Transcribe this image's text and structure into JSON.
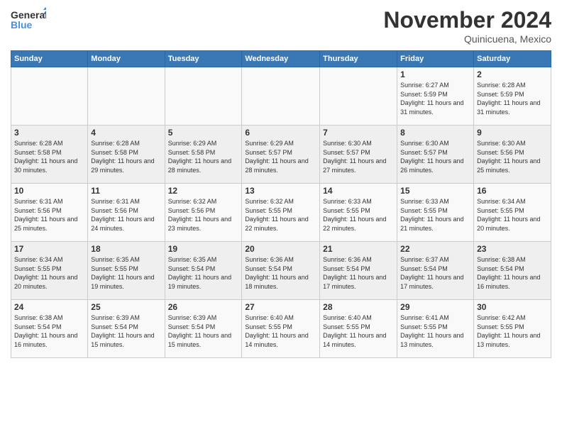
{
  "logo": {
    "line1": "General",
    "line2": "Blue"
  },
  "title": "November 2024",
  "subtitle": "Quinicuena, Mexico",
  "days_of_week": [
    "Sunday",
    "Monday",
    "Tuesday",
    "Wednesday",
    "Thursday",
    "Friday",
    "Saturday"
  ],
  "weeks": [
    [
      {
        "day": "",
        "info": ""
      },
      {
        "day": "",
        "info": ""
      },
      {
        "day": "",
        "info": ""
      },
      {
        "day": "",
        "info": ""
      },
      {
        "day": "",
        "info": ""
      },
      {
        "day": "1",
        "info": "Sunrise: 6:27 AM\nSunset: 5:59 PM\nDaylight: 11 hours and 31 minutes."
      },
      {
        "day": "2",
        "info": "Sunrise: 6:28 AM\nSunset: 5:59 PM\nDaylight: 11 hours and 31 minutes."
      }
    ],
    [
      {
        "day": "3",
        "info": "Sunrise: 6:28 AM\nSunset: 5:58 PM\nDaylight: 11 hours and 30 minutes."
      },
      {
        "day": "4",
        "info": "Sunrise: 6:28 AM\nSunset: 5:58 PM\nDaylight: 11 hours and 29 minutes."
      },
      {
        "day": "5",
        "info": "Sunrise: 6:29 AM\nSunset: 5:58 PM\nDaylight: 11 hours and 28 minutes."
      },
      {
        "day": "6",
        "info": "Sunrise: 6:29 AM\nSunset: 5:57 PM\nDaylight: 11 hours and 28 minutes."
      },
      {
        "day": "7",
        "info": "Sunrise: 6:30 AM\nSunset: 5:57 PM\nDaylight: 11 hours and 27 minutes."
      },
      {
        "day": "8",
        "info": "Sunrise: 6:30 AM\nSunset: 5:57 PM\nDaylight: 11 hours and 26 minutes."
      },
      {
        "day": "9",
        "info": "Sunrise: 6:30 AM\nSunset: 5:56 PM\nDaylight: 11 hours and 25 minutes."
      }
    ],
    [
      {
        "day": "10",
        "info": "Sunrise: 6:31 AM\nSunset: 5:56 PM\nDaylight: 11 hours and 25 minutes."
      },
      {
        "day": "11",
        "info": "Sunrise: 6:31 AM\nSunset: 5:56 PM\nDaylight: 11 hours and 24 minutes."
      },
      {
        "day": "12",
        "info": "Sunrise: 6:32 AM\nSunset: 5:56 PM\nDaylight: 11 hours and 23 minutes."
      },
      {
        "day": "13",
        "info": "Sunrise: 6:32 AM\nSunset: 5:55 PM\nDaylight: 11 hours and 22 minutes."
      },
      {
        "day": "14",
        "info": "Sunrise: 6:33 AM\nSunset: 5:55 PM\nDaylight: 11 hours and 22 minutes."
      },
      {
        "day": "15",
        "info": "Sunrise: 6:33 AM\nSunset: 5:55 PM\nDaylight: 11 hours and 21 minutes."
      },
      {
        "day": "16",
        "info": "Sunrise: 6:34 AM\nSunset: 5:55 PM\nDaylight: 11 hours and 20 minutes."
      }
    ],
    [
      {
        "day": "17",
        "info": "Sunrise: 6:34 AM\nSunset: 5:55 PM\nDaylight: 11 hours and 20 minutes."
      },
      {
        "day": "18",
        "info": "Sunrise: 6:35 AM\nSunset: 5:55 PM\nDaylight: 11 hours and 19 minutes."
      },
      {
        "day": "19",
        "info": "Sunrise: 6:35 AM\nSunset: 5:54 PM\nDaylight: 11 hours and 19 minutes."
      },
      {
        "day": "20",
        "info": "Sunrise: 6:36 AM\nSunset: 5:54 PM\nDaylight: 11 hours and 18 minutes."
      },
      {
        "day": "21",
        "info": "Sunrise: 6:36 AM\nSunset: 5:54 PM\nDaylight: 11 hours and 17 minutes."
      },
      {
        "day": "22",
        "info": "Sunrise: 6:37 AM\nSunset: 5:54 PM\nDaylight: 11 hours and 17 minutes."
      },
      {
        "day": "23",
        "info": "Sunrise: 6:38 AM\nSunset: 5:54 PM\nDaylight: 11 hours and 16 minutes."
      }
    ],
    [
      {
        "day": "24",
        "info": "Sunrise: 6:38 AM\nSunset: 5:54 PM\nDaylight: 11 hours and 16 minutes."
      },
      {
        "day": "25",
        "info": "Sunrise: 6:39 AM\nSunset: 5:54 PM\nDaylight: 11 hours and 15 minutes."
      },
      {
        "day": "26",
        "info": "Sunrise: 6:39 AM\nSunset: 5:54 PM\nDaylight: 11 hours and 15 minutes."
      },
      {
        "day": "27",
        "info": "Sunrise: 6:40 AM\nSunset: 5:55 PM\nDaylight: 11 hours and 14 minutes."
      },
      {
        "day": "28",
        "info": "Sunrise: 6:40 AM\nSunset: 5:55 PM\nDaylight: 11 hours and 14 minutes."
      },
      {
        "day": "29",
        "info": "Sunrise: 6:41 AM\nSunset: 5:55 PM\nDaylight: 11 hours and 13 minutes."
      },
      {
        "day": "30",
        "info": "Sunrise: 6:42 AM\nSunset: 5:55 PM\nDaylight: 11 hours and 13 minutes."
      }
    ]
  ]
}
